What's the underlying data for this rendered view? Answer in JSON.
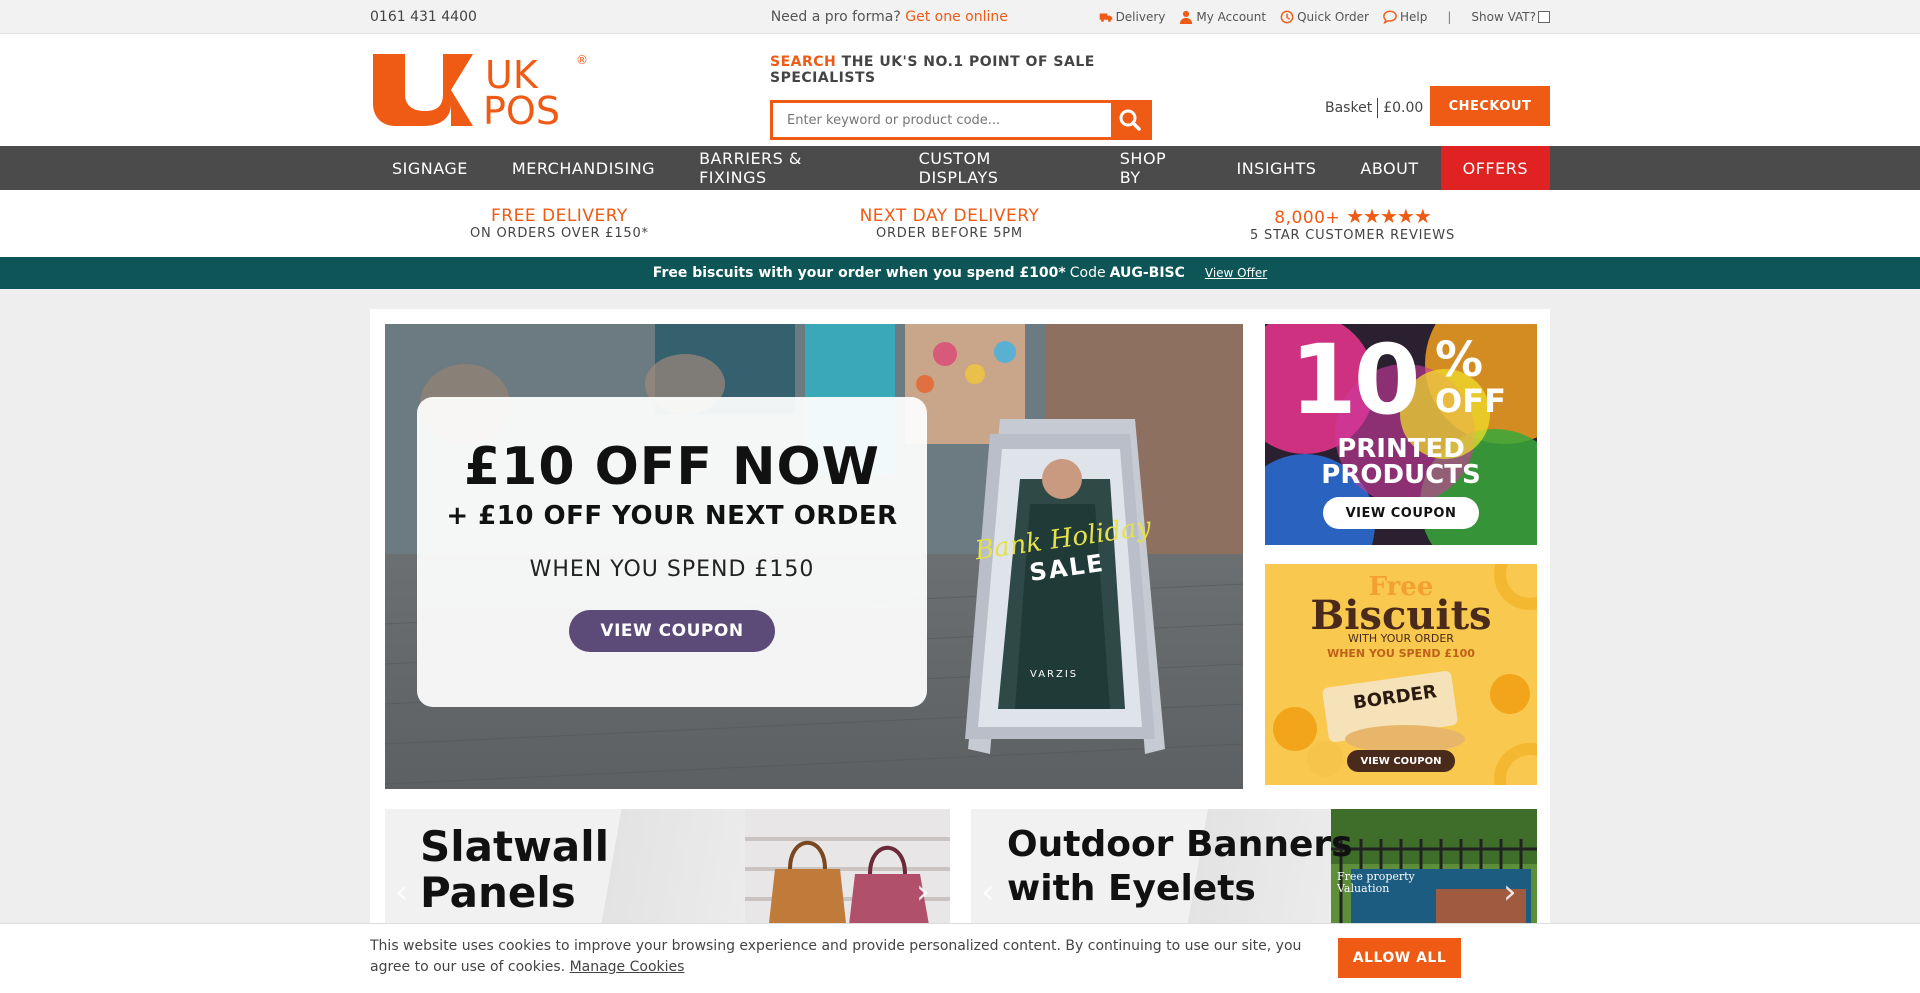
{
  "topbar": {
    "phone": "0161 431 4400",
    "pro_text": "Need a pro forma?",
    "pro_link": "Get one online",
    "links": [
      {
        "label": "Delivery",
        "icon": "truck-icon"
      },
      {
        "label": "My Account",
        "icon": "user-icon"
      },
      {
        "label": "Quick Order",
        "icon": "clock-icon"
      },
      {
        "label": "Help",
        "icon": "chat-icon"
      }
    ],
    "separator": "|",
    "vat_label": "Show VAT?"
  },
  "header": {
    "logo_text_uk": "UK",
    "logo_text_pos": "POS",
    "logo_reg": "®",
    "tagline_highlight": "SEARCH",
    "tagline_rest": "THE UK'S NO.1 POINT OF SALE SPECIALISTS",
    "search_placeholder": "Enter keyword or product code...",
    "basket_label": "Basket",
    "basket_total": "£0.00",
    "checkout_label": "CHECKOUT"
  },
  "nav": {
    "items": [
      "SIGNAGE",
      "MERCHANDISING",
      "BARRIERS & FIXINGS",
      "CUSTOM DISPLAYS",
      "SHOP BY",
      "INSIGHTS",
      "ABOUT",
      "OFFERS"
    ]
  },
  "usp": [
    {
      "top": "FREE DELIVERY",
      "bottom": "ON ORDERS OVER £150*"
    },
    {
      "top": "NEXT DAY DELIVERY",
      "bottom": "ORDER BEFORE 5PM"
    },
    {
      "top": "8,000+",
      "stars": "★★★★★",
      "bottom": "5 STAR CUSTOMER REVIEWS"
    }
  ],
  "promobar": {
    "bold_text": "Free biscuits with your order when you spend £100*",
    "code_label": "Code",
    "code": "AUG-BISC",
    "link": "View Offer"
  },
  "hero": {
    "line1": "£10 OFF NOW",
    "line2": "+ £10 OFF YOUR NEXT ORDER",
    "line3": "WHEN YOU SPEND £150",
    "button": "VIEW COUPON",
    "board_script": "Bank Holiday",
    "board_sale": "SALE",
    "board_brand": "VARZIS"
  },
  "side_promo_1": {
    "big": "10",
    "percent": "%",
    "off": "OFF",
    "line1": "PRINTED",
    "line2": "PRODUCTS",
    "button": "VIEW COUPON"
  },
  "side_promo_2": {
    "free": "Free",
    "biscuits": "Biscuits",
    "line1": "WITH YOUR ORDER",
    "line2": "WHEN YOU SPEND £100",
    "pack": "BORDER",
    "button": "VIEW COUPON"
  },
  "bottom_banners": [
    {
      "line1": "Slatwall",
      "line2": "Panels"
    },
    {
      "line1": "Outdoor Banners",
      "line2": "with Eyelets",
      "sign_text": "Free property Valuation"
    }
  ],
  "cookie": {
    "text": "This website uses cookies to improve your browsing experience and provide personalized content. By continuing to use our site, you agree to our use of cookies.",
    "manage": "Manage Cookies",
    "allow": "ALLOW ALL"
  },
  "colors": {
    "brand_orange": "#ef5a14",
    "nav_bg": "#4b4b4b",
    "offers_red": "#e02222",
    "promobar_teal": "#0e5557"
  }
}
